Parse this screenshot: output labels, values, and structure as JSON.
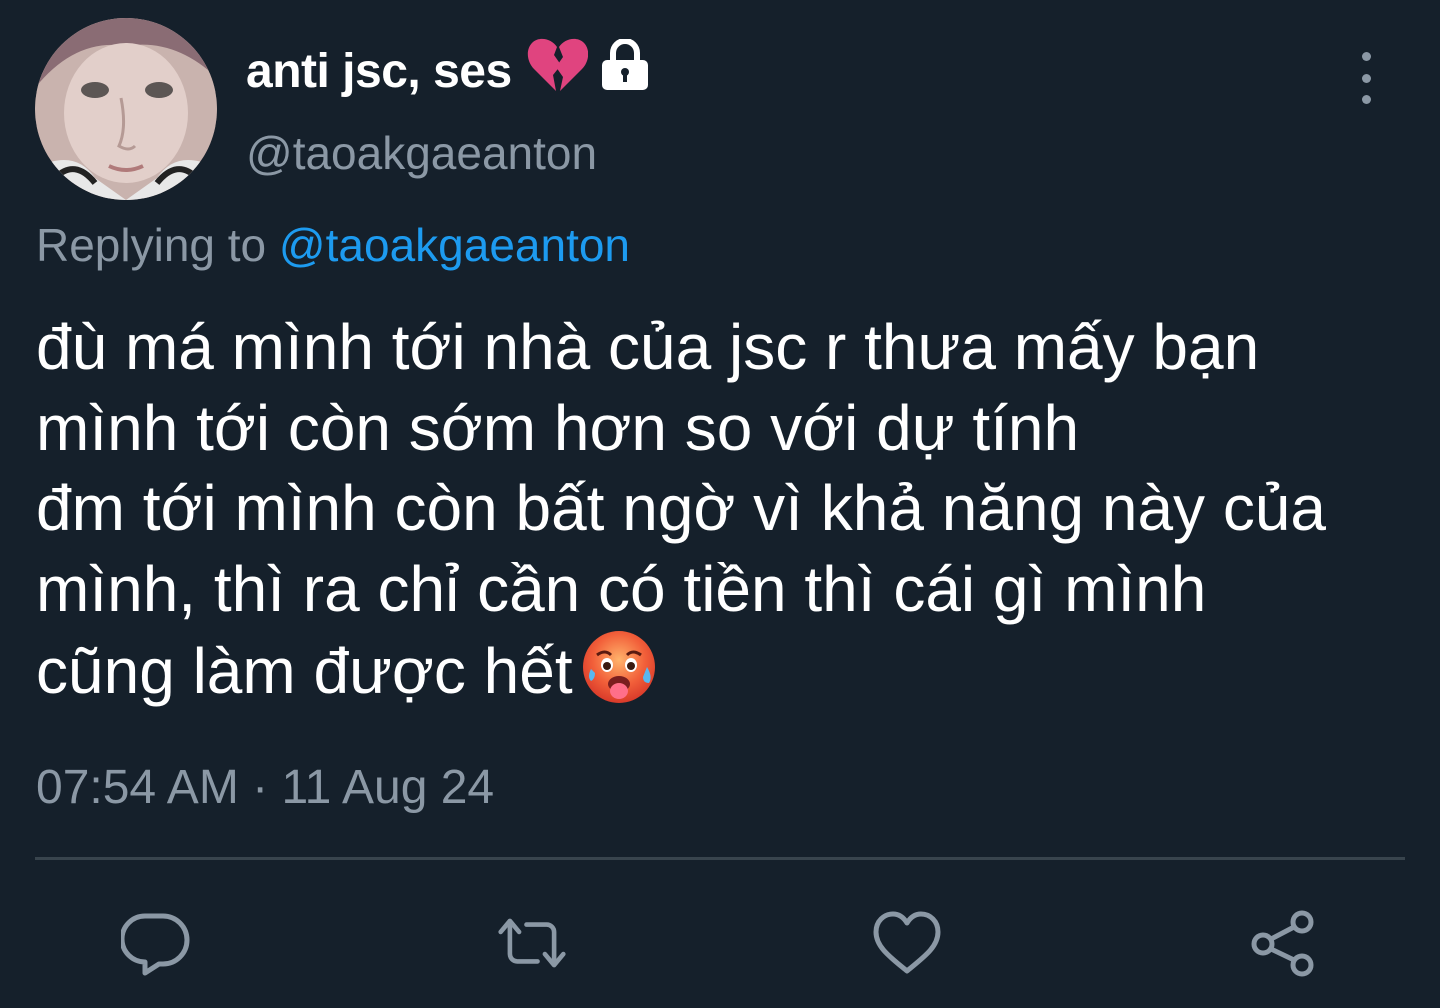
{
  "tweet": {
    "display_name": "anti jsc, ses",
    "name_emoji_icon": "broken-heart-icon",
    "protected_icon": "lock-icon",
    "handle": "@taoakgaeanton",
    "replying_prefix": "Replying to",
    "replying_handle": "@taoakgaeanton",
    "text": "đù má mình tới nhà của jsc r thưa mấy bạn\nmình tới còn sớm hơn so với dự tính\nđm tới mình còn bất ngờ vì khả năng này của\nmình, thì ra chỉ cần có tiền thì cái gì mình\ncũng làm được hết",
    "text_emoji_icon": "hot-face-icon",
    "timestamp": "07:54 AM · 11 Aug 24"
  },
  "actions": [
    {
      "icon": "reply-icon"
    },
    {
      "icon": "retweet-icon"
    },
    {
      "icon": "like-icon"
    },
    {
      "icon": "share-icon"
    }
  ],
  "colors": {
    "background": "#15202b",
    "text_primary": "#ffffff",
    "text_secondary": "#8b98a5",
    "link": "#1d9bf0",
    "divider": "#38444d",
    "broken_heart": "#e0447f"
  }
}
